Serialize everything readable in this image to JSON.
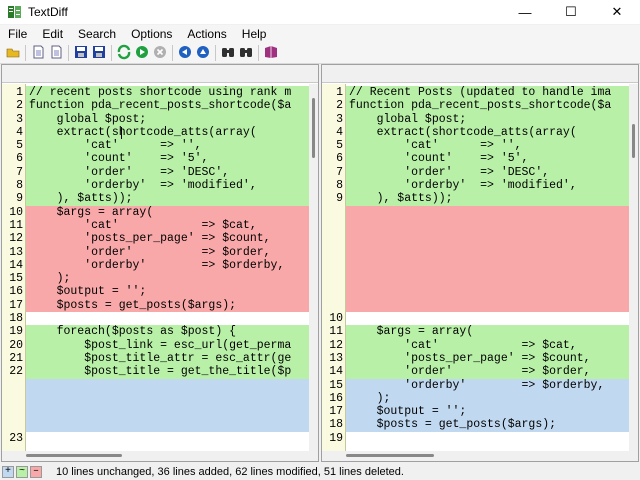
{
  "window": {
    "title": "TextDiff"
  },
  "controls": {
    "minimize": "—",
    "maximize": "☐",
    "close": "✕"
  },
  "menu": [
    "File",
    "Edit",
    "Search",
    "Options",
    "Actions",
    "Help"
  ],
  "toolbar": [
    {
      "name": "open-folder-icon",
      "color": "#e8b820"
    },
    {
      "sep": true
    },
    {
      "name": "open-file-left-icon",
      "color": "#c0c0e0"
    },
    {
      "name": "open-file-right-icon",
      "color": "#c0c0e0"
    },
    {
      "sep": true
    },
    {
      "name": "save-left-icon",
      "color": "#2040a0"
    },
    {
      "name": "save-right-icon",
      "color": "#2040a0"
    },
    {
      "sep": true
    },
    {
      "name": "refresh-icon",
      "color": "#20a040"
    },
    {
      "name": "run-compare-icon",
      "color": "#20a040"
    },
    {
      "name": "stop-icon",
      "color": "#b0b0b0"
    },
    {
      "sep": true
    },
    {
      "name": "previous-diff-icon",
      "color": "#2060c0"
    },
    {
      "name": "next-diff-icon",
      "color": "#2060c0"
    },
    {
      "sep": true
    },
    {
      "name": "find-icon",
      "color": "#303030"
    },
    {
      "name": "find-next-icon",
      "color": "#303030"
    },
    {
      "sep": true
    },
    {
      "name": "help-book-icon",
      "color": "#a03080"
    }
  ],
  "left": {
    "lines": [
      {
        "n": "1",
        "t": "// recent posts shortcode using rank m",
        "s": "modified"
      },
      {
        "n": "2",
        "t": "function pda_recent_posts_shortcode($a",
        "s": "modified"
      },
      {
        "n": "3",
        "t": "    global $post;",
        "s": "modified"
      },
      {
        "n": "4",
        "t": "    extract(shortcode_atts(array(",
        "s": "modified"
      },
      {
        "n": "5",
        "t": "        'cat'      => '',",
        "s": "modified"
      },
      {
        "n": "6",
        "t": "        'count'    => '5',",
        "s": "modified"
      },
      {
        "n": "7",
        "t": "        'order'    => 'DESC',",
        "s": "modified"
      },
      {
        "n": "8",
        "t": "        'orderby'  => 'modified',",
        "s": "modified"
      },
      {
        "n": "9",
        "t": "    ), $atts));",
        "s": "modified"
      },
      {
        "n": "10",
        "t": "    $args = array(",
        "s": "deleted"
      },
      {
        "n": "11",
        "t": "        'cat'            => $cat,",
        "s": "deleted"
      },
      {
        "n": "12",
        "t": "        'posts_per_page' => $count,",
        "s": "deleted"
      },
      {
        "n": "13",
        "t": "        'order'          => $order,",
        "s": "deleted"
      },
      {
        "n": "14",
        "t": "        'orderby'        => $orderby,",
        "s": "deleted"
      },
      {
        "n": "15",
        "t": "    );",
        "s": "deleted"
      },
      {
        "n": "16",
        "t": "    $output = '';",
        "s": "deleted"
      },
      {
        "n": "17",
        "t": "    $posts = get_posts($args);",
        "s": "deleted"
      },
      {
        "n": "18",
        "t": "",
        "s": "unchanged"
      },
      {
        "n": "19",
        "t": "    foreach($posts as $post) {",
        "s": "modified"
      },
      {
        "n": "20",
        "t": "        $post_link = esc_url(get_perma",
        "s": "modified"
      },
      {
        "n": "21",
        "t": "        $post_title_attr = esc_attr(ge",
        "s": "modified"
      },
      {
        "n": "22",
        "t": "        $post_title = get_the_title($p",
        "s": "modified"
      },
      {
        "n": "",
        "t": "",
        "s": "added"
      },
      {
        "n": "",
        "t": "",
        "s": "added"
      },
      {
        "n": "",
        "t": "",
        "s": "added"
      },
      {
        "n": "",
        "t": "",
        "s": "added"
      },
      {
        "n": "23",
        "t": "",
        "s": "blank"
      }
    ]
  },
  "right": {
    "lines": [
      {
        "n": "1",
        "t": "// Recent Posts (updated to handle ima",
        "s": "modified"
      },
      {
        "n": "2",
        "t": "function pda_recent_posts_shortcode($a",
        "s": "modified"
      },
      {
        "n": "3",
        "t": "    global $post;",
        "s": "modified"
      },
      {
        "n": "4",
        "t": "    extract(shortcode_atts(array(",
        "s": "modified"
      },
      {
        "n": "5",
        "t": "        'cat'      => '',",
        "s": "modified"
      },
      {
        "n": "6",
        "t": "        'count'    => '5',",
        "s": "modified"
      },
      {
        "n": "7",
        "t": "        'order'    => 'DESC',",
        "s": "modified"
      },
      {
        "n": "8",
        "t": "        'orderby'  => 'modified',",
        "s": "modified"
      },
      {
        "n": "9",
        "t": "    ), $atts));",
        "s": "modified"
      },
      {
        "n": "",
        "t": "",
        "s": "deleted"
      },
      {
        "n": "",
        "t": "",
        "s": "deleted"
      },
      {
        "n": "",
        "t": "",
        "s": "deleted"
      },
      {
        "n": "",
        "t": "",
        "s": "deleted"
      },
      {
        "n": "",
        "t": "",
        "s": "deleted"
      },
      {
        "n": "",
        "t": "",
        "s": "deleted"
      },
      {
        "n": "",
        "t": "",
        "s": "deleted"
      },
      {
        "n": "",
        "t": "",
        "s": "deleted"
      },
      {
        "n": "10",
        "t": "",
        "s": "unchanged"
      },
      {
        "n": "11",
        "t": "    $args = array(",
        "s": "modified"
      },
      {
        "n": "12",
        "t": "        'cat'            => $cat,",
        "s": "modified"
      },
      {
        "n": "13",
        "t": "        'posts_per_page' => $count,",
        "s": "modified"
      },
      {
        "n": "14",
        "t": "        'order'          => $order,",
        "s": "modified"
      },
      {
        "n": "15",
        "t": "        'orderby'        => $orderby,",
        "s": "added"
      },
      {
        "n": "16",
        "t": "    );",
        "s": "added"
      },
      {
        "n": "17",
        "t": "    $output = '';",
        "s": "added"
      },
      {
        "n": "18",
        "t": "    $posts = get_posts($args);",
        "s": "added"
      },
      {
        "n": "19",
        "t": "",
        "s": "blank"
      }
    ]
  },
  "legend": {
    "added": "+",
    "modified": "~",
    "deleted": "–"
  },
  "status": "10 lines unchanged,  36 lines added, 62 lines modified, 51 lines deleted.",
  "colors": {
    "modified": "#b8f0a8",
    "deleted": "#f8a8a8",
    "added": "#c0d8f0",
    "gutter": "#fafae0"
  }
}
